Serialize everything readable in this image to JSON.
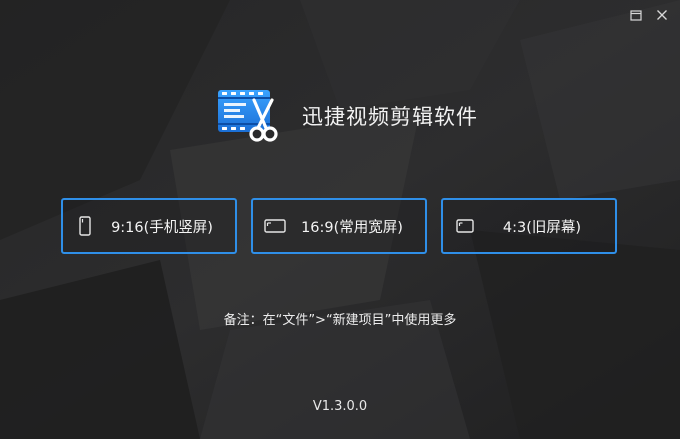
{
  "window": {
    "restore_icon": "restore-icon",
    "close_icon": "close-icon"
  },
  "app": {
    "title": "迅捷视频剪辑软件",
    "logo_icon": "film-scissors-icon",
    "accent_color": "#2f8fe8"
  },
  "ratios": [
    {
      "label": "9:16(手机竖屏)",
      "icon": "portrait-icon"
    },
    {
      "label": "16:9(常用宽屏)",
      "icon": "widescreen-icon"
    },
    {
      "label": "4:3(旧屏幕)",
      "icon": "standard-screen-icon"
    }
  ],
  "note": "备注：在“文件”>“新建项目”中使用更多",
  "version": "V1.3.0.0"
}
